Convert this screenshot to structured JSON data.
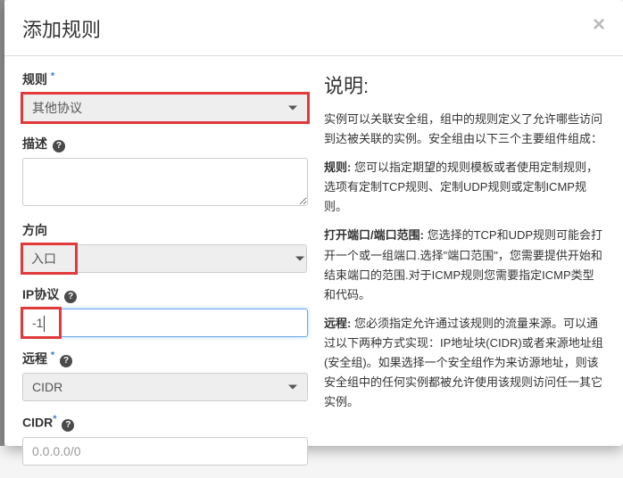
{
  "header": {
    "title": "添加规则",
    "close": "×"
  },
  "form": {
    "rule": {
      "label": "规则",
      "value": "其他协议"
    },
    "description": {
      "label": "描述",
      "value": ""
    },
    "direction": {
      "label": "方向",
      "value": "入口"
    },
    "ip_protocol": {
      "label": "IP协议",
      "value": "-1"
    },
    "remote": {
      "label": "远程",
      "value": "CIDR"
    },
    "cidr": {
      "label": "CIDR",
      "value": "0.0.0.0/0"
    }
  },
  "description": {
    "title": "说明:",
    "intro": "实例可以关联安全组，组中的规则定义了允许哪些访问到达被关联的实例。安全组由以下三个主要组件组成：",
    "rule_label": "规则:",
    "rule_text": "  您可以指定期望的规则模板或者使用定制规则，选项有定制TCP规则、定制UDP规则或定制ICMP规则。",
    "port_label": "打开端口/端口范围:",
    "port_text": "  您选择的TCP和UDP规则可能会打开一个或一组端口.选择\"端口范围\"，您需要提供开始和结束端口的范围.对于ICMP规则您需要指定ICMP类型和代码。",
    "remote_label": "远程:",
    "remote_text": "  您必须指定允许通过该规则的流量来源。可以通过以下两种方式实现：IP地址块(CIDR)或者来源地址组(安全组)。如果选择一个安全组作为来访源地址，则该安全组中的任何实例都被允许使用该规则访问任一其它实例。"
  },
  "bg_number": "3"
}
